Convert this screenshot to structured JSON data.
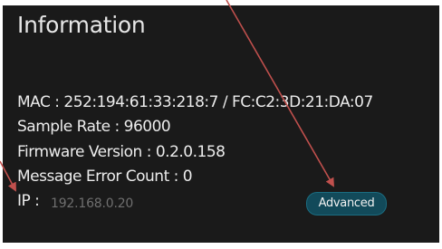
{
  "panel": {
    "title": "Information",
    "mac_line": "MAC : 252:194:61:33:218:7 / FC:C2:3D:21:DA:07",
    "sample_rate_line": "Sample Rate : 96000",
    "firmware_line": "Firmware Version : 0.2.0.158",
    "error_count_line": "Message Error Count : 0",
    "ip_label": "IP :",
    "ip_value": "192.168.0.20",
    "advanced_label": "Advanced"
  },
  "colors": {
    "panel_background": "#1a1a1a",
    "text": "#ececec",
    "ip_value": "#6f6f6f",
    "button_background": "#124a5a",
    "button_border": "#1b6c80",
    "annotation_arrow": "#c0504d"
  }
}
